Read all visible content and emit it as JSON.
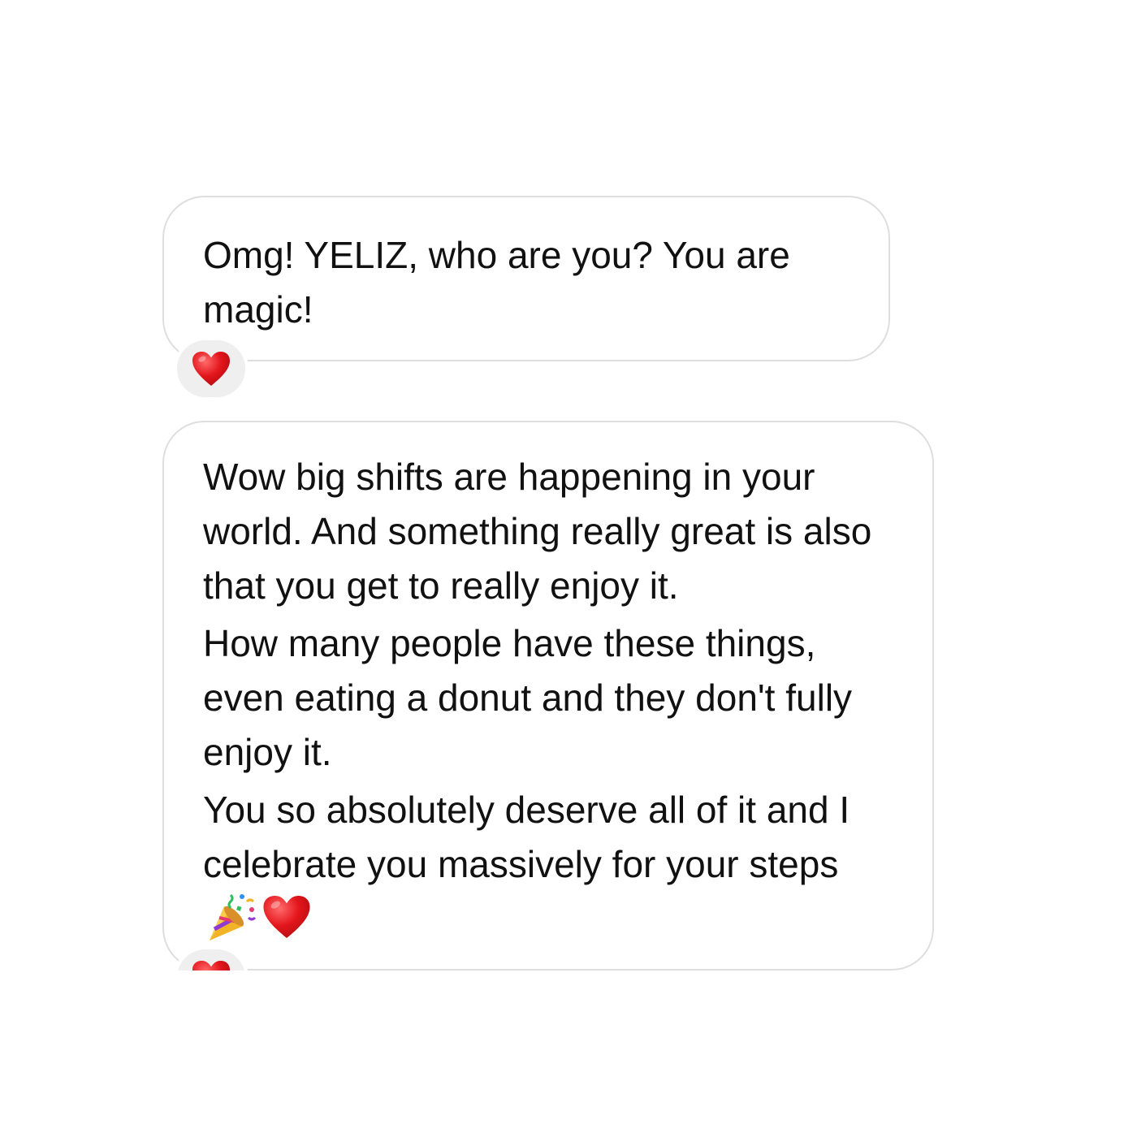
{
  "messages": [
    {
      "paragraphs": [
        "Omg! YELIZ, who are you? You are magic!"
      ],
      "reaction": "heart-emoji"
    },
    {
      "paragraphs": [
        "Wow big shifts are happening in your world. And something really great is also that you get to really enjoy it.",
        "How many people have these things, even eating a donut and they don't fully enjoy it.",
        "You so absolutely deserve all of it and I celebrate you massively for your steps"
      ],
      "trailing_emojis": [
        "party-popper-emoji",
        "heart-emoji"
      ],
      "reaction": "heart-emoji"
    }
  ],
  "colors": {
    "bubble_border": "#dedede",
    "reaction_background": "#efefef",
    "heart": "#e3161c",
    "text": "#111111"
  }
}
